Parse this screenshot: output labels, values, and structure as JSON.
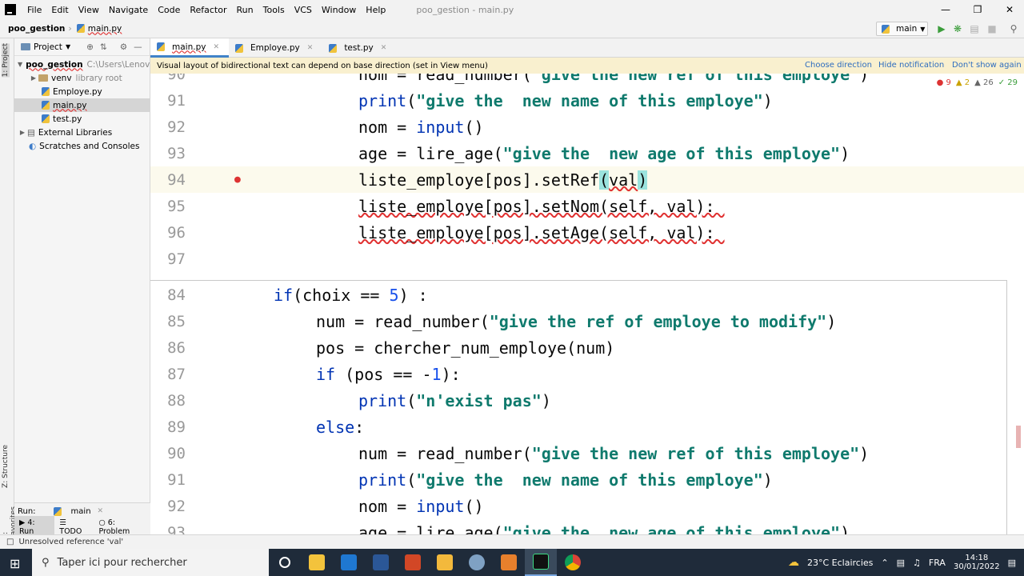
{
  "menu": {
    "items": [
      "File",
      "Edit",
      "View",
      "Navigate",
      "Code",
      "Refactor",
      "Run",
      "Tools",
      "VCS",
      "Window",
      "Help"
    ],
    "window_title": "poo_gestion - main.py"
  },
  "nav": {
    "project": "poo_gestion",
    "file": "main.py",
    "run_config": "main"
  },
  "project_panel": {
    "title": "Project",
    "tree": [
      {
        "label": "poo_gestion",
        "hint": "C:\\Users\\Lenovo",
        "type": "folder"
      },
      {
        "label": "venv",
        "hint": "library root",
        "type": "folder"
      },
      {
        "label": "Employe.py",
        "hint": "",
        "type": "file"
      },
      {
        "label": "main.py",
        "hint": "",
        "type": "file"
      },
      {
        "label": "test.py",
        "hint": "",
        "type": "file"
      },
      {
        "label": "External Libraries",
        "hint": "",
        "type": "lib"
      },
      {
        "label": "Scratches and Consoles",
        "hint": "",
        "type": "scratch"
      }
    ],
    "side_tabs": [
      "1: Project",
      "Z: Structure",
      "2: Favorites"
    ]
  },
  "tabs": [
    "main.py",
    "Employe.py",
    "test.py"
  ],
  "notification": {
    "text": "Visual layout of bidirectional text can depend on base direction (set in View menu)",
    "choose": "Choose direction",
    "hide": "Hide notification",
    "dont_show": "Don't show again"
  },
  "inspections": {
    "errors": "9",
    "warnings": "2",
    "weak": "26",
    "typos": "29"
  },
  "editor_top": [
    {
      "n": "90",
      "code": "nom = read_number(\"give the new ref of this employe\")"
    },
    {
      "n": "91",
      "code": "print(\"give the  new name of this employe\")"
    },
    {
      "n": "92",
      "code": "nom = input()"
    },
    {
      "n": "93",
      "code": "age = lire_age(\"give the  new age of this employe\")"
    },
    {
      "n": "94",
      "code": "liste_employe[pos].setRef(val)"
    },
    {
      "n": "95",
      "code": "liste_employe[pos].setNom(self, val):"
    },
    {
      "n": "96",
      "code": "liste_employe[pos].setAge(self, val):"
    },
    {
      "n": "97",
      "code": ""
    }
  ],
  "editor_popup": [
    {
      "n": "84",
      "code": "if(choix == 5) :"
    },
    {
      "n": "85",
      "code": "num = read_number(\"give the ref of employe to modify\")"
    },
    {
      "n": "86",
      "code": "pos = chercher_num_employe(num)"
    },
    {
      "n": "87",
      "code": "if (pos == -1):"
    },
    {
      "n": "88",
      "code": "print(\"n'exist pas\")"
    },
    {
      "n": "89",
      "code": "else:"
    },
    {
      "n": "90",
      "code": "num = read_number(\"give the new ref of this employe\")"
    },
    {
      "n": "91",
      "code": "print(\"give the  new name of this employe\")"
    },
    {
      "n": "92",
      "code": "nom = input()"
    },
    {
      "n": "93",
      "code": "age = lire_age(\"give the  new age of this employe\")"
    }
  ],
  "run_panel": {
    "label": "Run:",
    "config": "main",
    "tabs": [
      "4: Run",
      "TODO",
      "6: Problem"
    ]
  },
  "status": "Unresolved reference 'val'",
  "taskbar": {
    "search_placeholder": "Taper ici pour rechercher",
    "weather": "23°C  Eclaircies",
    "lang": "FRA",
    "time": "14:18",
    "date": "30/01/2022"
  }
}
